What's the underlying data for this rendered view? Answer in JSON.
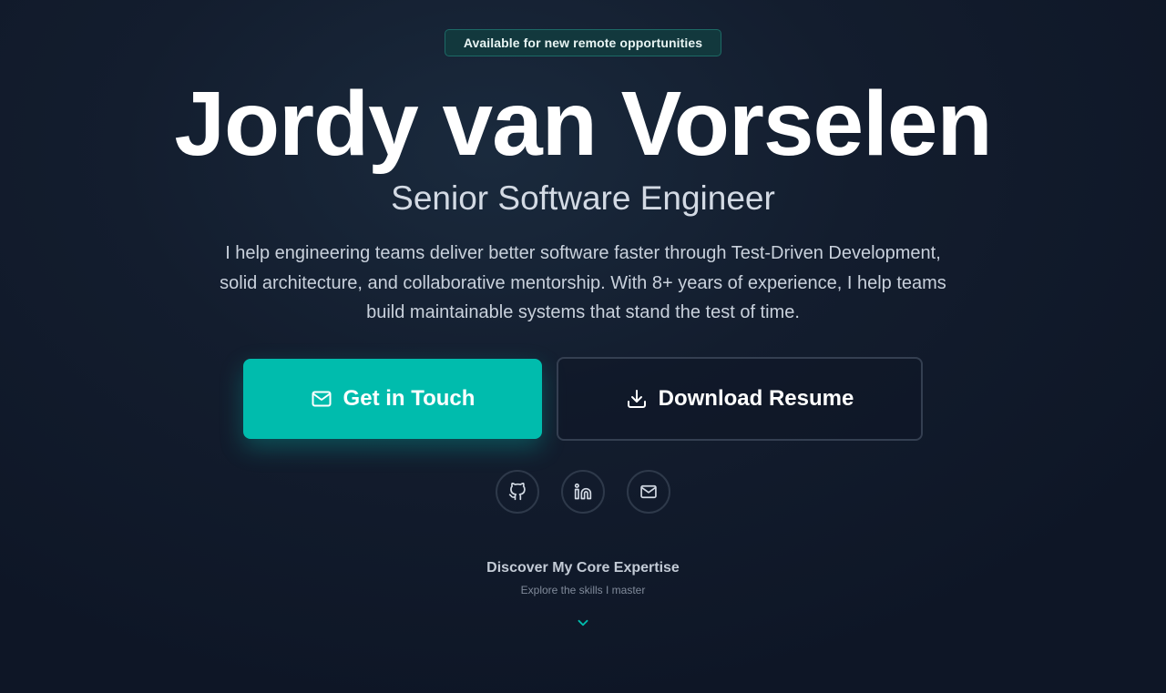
{
  "hero": {
    "badge": "Available for new remote opportunities",
    "name": "Jordy van Vorselen",
    "role": "Senior Software Engineer",
    "intro": "I help engineering teams deliver better software faster through Test-Driven Development, solid architecture, and collaborative mentorship. With 8+ years of experience, I help teams build maintainable systems that stand the test of time."
  },
  "actions": {
    "primary": {
      "label": "Get in Touch",
      "icon": "mail-icon"
    },
    "secondary": {
      "label": "Download Resume",
      "icon": "download-icon"
    }
  },
  "social": [
    {
      "icon": "github-icon"
    },
    {
      "icon": "linkedin-icon"
    },
    {
      "icon": "mail-icon"
    }
  ],
  "discover": {
    "title": "Discover My Core Expertise",
    "subtitle": "Explore the skills I master",
    "icon": "chevron-down-icon"
  },
  "colors": {
    "accent": "#00bcad",
    "background": "#0e1626",
    "badge_bg": "#12383d",
    "text": "#ffffff"
  }
}
